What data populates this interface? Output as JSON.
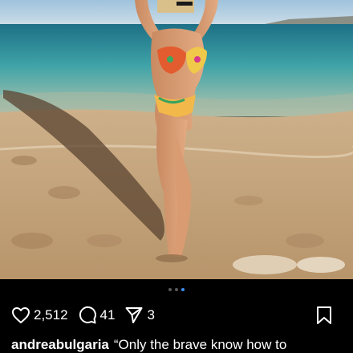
{
  "post": {
    "image": {
      "subject": "photo"
    },
    "carousel": {
      "total": 3,
      "active_index": 2
    },
    "actions": {
      "likes": "2,512",
      "comments": "41",
      "shares": "3"
    },
    "caption": {
      "username": "andreabulgaria",
      "text": "“Only the brave know how to"
    }
  },
  "colors": {
    "background": "#000000",
    "text": "#ffffff",
    "carousel_active": "#3b8ef0",
    "carousel_inactive": "#5a5a5a"
  },
  "icons": [
    "heart-icon",
    "comment-icon",
    "share-icon",
    "bookmark-icon"
  ]
}
